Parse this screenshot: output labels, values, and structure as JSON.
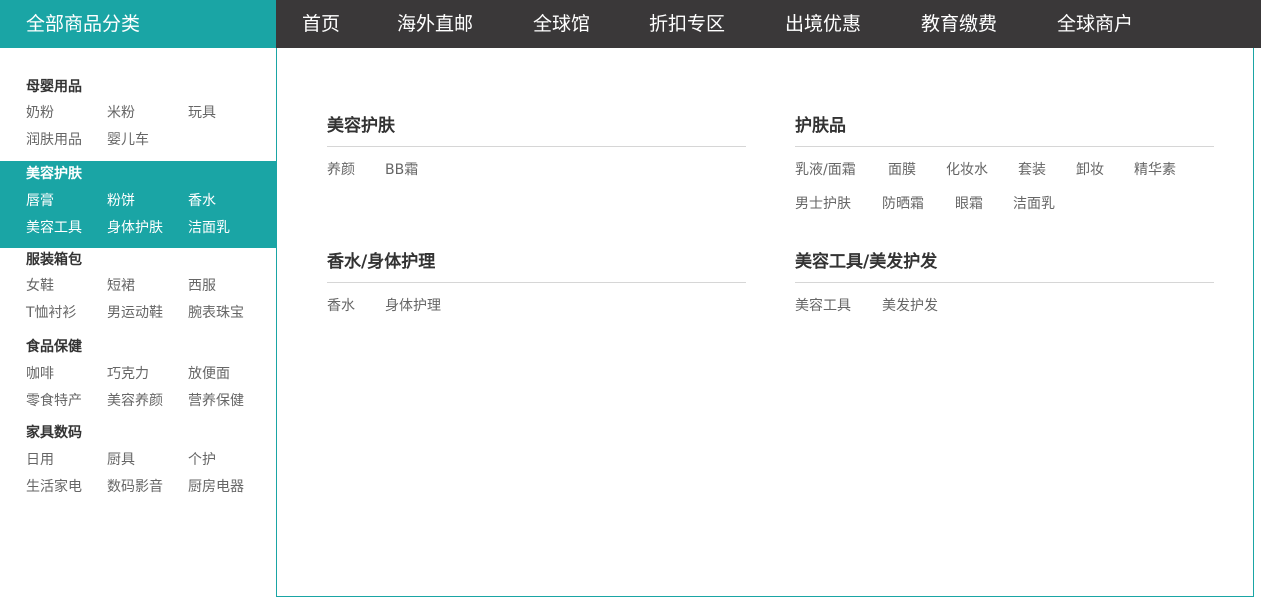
{
  "header": {
    "all_categories": "全部商品分类",
    "nav": [
      "首页",
      "海外直邮",
      "全球馆",
      "折扣专区",
      "出境优惠",
      "教育缴费",
      "全球商户"
    ]
  },
  "sidebar": {
    "categories": [
      {
        "title": "母婴用品",
        "items": [
          "奶粉",
          "米粉",
          "玩具",
          "润肤用品",
          "婴儿车"
        ],
        "active": false
      },
      {
        "title": "美容护肤",
        "items": [
          "唇膏",
          "粉饼",
          "香水",
          "美容工具",
          "身体护肤",
          "洁面乳"
        ],
        "active": true
      },
      {
        "title": "服装箱包",
        "items": [
          "女鞋",
          "短裙",
          "西服",
          "T恤衬衫",
          "男运动鞋",
          "腕表珠宝"
        ],
        "active": false
      },
      {
        "title": "食品保健",
        "items": [
          "咖啡",
          "巧克力",
          "放便面",
          "零食特产",
          "美容养颜",
          "营养保健"
        ],
        "active": false
      },
      {
        "title": "家具数码",
        "items": [
          "日用",
          "厨具",
          "个护",
          "生活家电",
          "数码影音",
          "厨房电器"
        ],
        "active": false
      }
    ]
  },
  "panel": {
    "groups": [
      {
        "title": "美容护肤",
        "items": [
          "养颜",
          "BB霜"
        ]
      },
      {
        "title": "护肤品",
        "items": [
          "乳液/面霜",
          "面膜",
          "化妆水",
          "套装",
          "卸妆",
          "精华素",
          "男士护肤",
          "防晒霜",
          "眼霜",
          "洁面乳"
        ]
      },
      {
        "title": "香水/身体护理",
        "items": [
          "香水",
          "身体护理"
        ]
      },
      {
        "title": "美容工具/美发护发",
        "items": [
          "美容工具",
          "美发护发"
        ]
      }
    ]
  },
  "colors": {
    "accent": "#1aa5a5",
    "topbar": "#3a3839"
  }
}
